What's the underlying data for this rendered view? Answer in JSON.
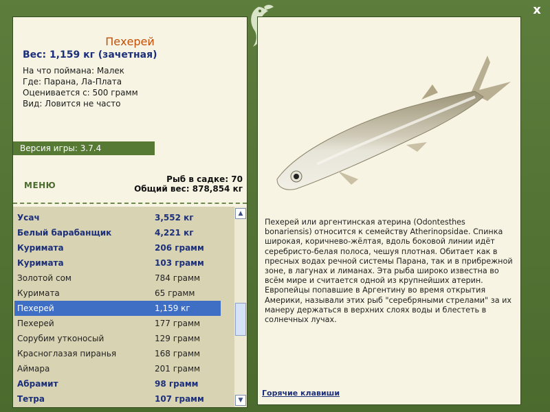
{
  "fish": {
    "name": "Пехерей",
    "weight": "Вес: 1,159 кг (зачетная)",
    "bait": "На что поймана: Малек",
    "where": "Где: Парана, Ла-Плата",
    "value": "Оценивается с:  500 грамм",
    "kind": "Вид: Ловится не часто"
  },
  "version": "Версия игры: 3.7.4",
  "menu_label": "МЕНЮ",
  "stats": {
    "count": "Рыб в садке: 70",
    "total": "Общий вес: 878,854 кг"
  },
  "list": [
    {
      "name": "Усач",
      "weight": "3,552 кг",
      "style": "bold"
    },
    {
      "name": "Белый барабанщик",
      "weight": "4,221 кг",
      "style": "bold"
    },
    {
      "name": "Куримата",
      "weight": "206 грамм",
      "style": "bold"
    },
    {
      "name": "Куримата",
      "weight": "103 грамм",
      "style": "bold"
    },
    {
      "name": "Золотой сом",
      "weight": "784 грамм",
      "style": "plain"
    },
    {
      "name": "Куримата",
      "weight": "65 грамм",
      "style": "plain"
    },
    {
      "name": "Пехерей",
      "weight": "1,159 кг",
      "style": "sel"
    },
    {
      "name": "Пехерей",
      "weight": "177 грамм",
      "style": "plain"
    },
    {
      "name": "Сорубим утконосый",
      "weight": "129 грамм",
      "style": "plain"
    },
    {
      "name": "Красноглазая пиранья",
      "weight": "168 грамм",
      "style": "plain"
    },
    {
      "name": "Аймара",
      "weight": "201 грамм",
      "style": "plain"
    },
    {
      "name": "Абрамит",
      "weight": "98 грамм",
      "style": "bold"
    },
    {
      "name": "Тетра",
      "weight": "107 грамм",
      "style": "bold"
    }
  ],
  "description": "Пехерей или аргентинская атерина (Odontesthes bonariensis) относится к семейству Atherinopsidae. Спинка широкая, коричнево-жёлтая, вдоль боковой линии идёт серебристо-белая полоса, чешуя плотная. Обитает как в пресных водах речной системы Парана, так и в прибрежной зоне, в лагунах и лиманах. Эта рыба широко известна во всём мире и считается одной из крупнейших атерин. Европейцы попавшие в Аргентину во время открытия Америки, называли этих рыб \"серебряными стрелами\" за их манеру держаться в верхних слоях воды и блестеть в солнечных лучах.",
  "hotkeys_label": "Горячие клавиши",
  "close_label": "x",
  "icons": {
    "close": "close-icon",
    "logo": "fish-logo-icon",
    "scroll_up": "arrow-up-icon",
    "scroll_down": "arrow-down-icon"
  },
  "colors": {
    "frame": "#4e6e32",
    "panel": "#f7f4e3",
    "accent_blue": "#1c2f7a",
    "title_orange": "#c0500a",
    "selected": "#3f6fc4"
  }
}
